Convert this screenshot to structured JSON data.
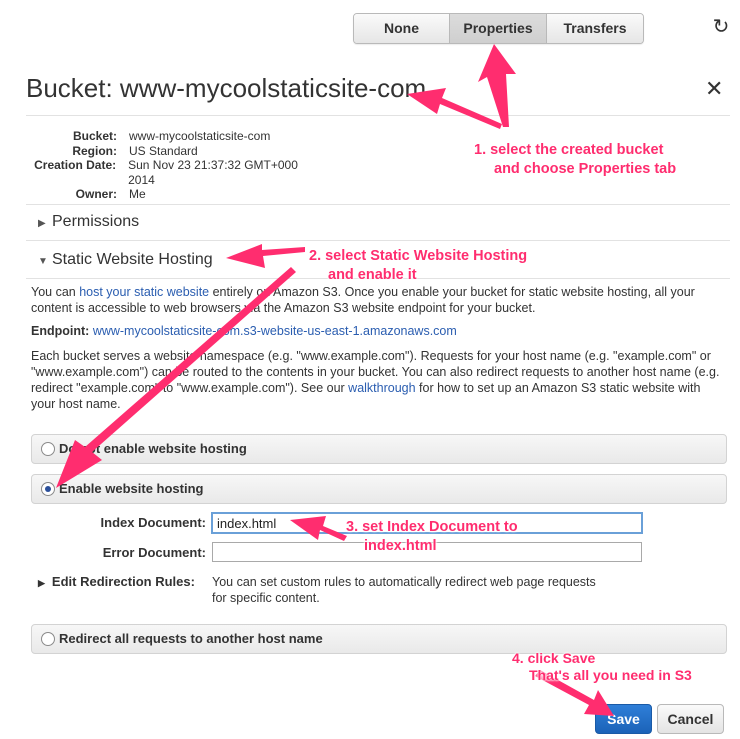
{
  "toolbar": {
    "segments": [
      {
        "label": "None",
        "active": false
      },
      {
        "label": "Properties",
        "active": true
      },
      {
        "label": "Transfers",
        "active": false
      }
    ],
    "refresh_icon": "↻"
  },
  "panel": {
    "title": "Bucket: www-mycoolstaticsite-com",
    "close_icon": "✕"
  },
  "bucket_info": [
    {
      "key": "Bucket:",
      "value": "www-mycoolstaticsite-com"
    },
    {
      "key": "Region:",
      "value": "US Standard"
    },
    {
      "key": "Creation Date:",
      "value": "Sun Nov 23 21:37:32 GMT+000 2014"
    },
    {
      "key": "Owner:",
      "value": "Me"
    }
  ],
  "sections": {
    "permissions": "Permissions",
    "static_hosting": "Static Website Hosting"
  },
  "hosting": {
    "intro_1": "You can ",
    "intro_link": "host your static website",
    "intro_2": " entirely on Amazon S3. Once you enable your bucket for static website hosting, all your content is accessible to web browsers via the Amazon S3 website endpoint for your bucket.",
    "endpoint_label": "Endpoint:",
    "endpoint_value": "www-mycoolstaticsite-com.s3-website-us-east-1.amazonaws.com",
    "namespace_1": "Each bucket serves a website namespace (e.g. \"www.example.com\"). Requests for your host name (e.g. \"example.com\" or \"www.example.com\") can be routed to the contents in your bucket. You can also redirect requests to another host name (e.g. redirect \"example.com\" to \"www.example.com\"). See our ",
    "namespace_link": "walkthrough",
    "namespace_2": " for how to set up an Amazon S3 static website with your host name."
  },
  "options": {
    "disable": "Do not enable website hosting",
    "enable": "Enable website hosting",
    "redirect": "Redirect all requests to another host name",
    "selected": "enable"
  },
  "form": {
    "index_label": "Index Document:",
    "index_value": "index.html",
    "error_label": "Error Document:",
    "error_value": "",
    "redirect_rules_label": "Edit Redirection Rules:",
    "redirect_rules_desc": "You can set custom rules to automatically redirect web page requests for specific content."
  },
  "buttons": {
    "save": "Save",
    "cancel": "Cancel"
  },
  "annotations": {
    "note1_line1": "1. select the created bucket",
    "note1_line2": "and choose Properties tab",
    "note2_line1": "2. select Static Website Hosting",
    "note2_line2": "and enable it",
    "note3_line1": "3. set Index Document to",
    "note3_line2": "index.html",
    "note4_line1": "4. click Save",
    "note4_line2": "That's all you need in S3",
    "color": "#ff2d6f"
  }
}
